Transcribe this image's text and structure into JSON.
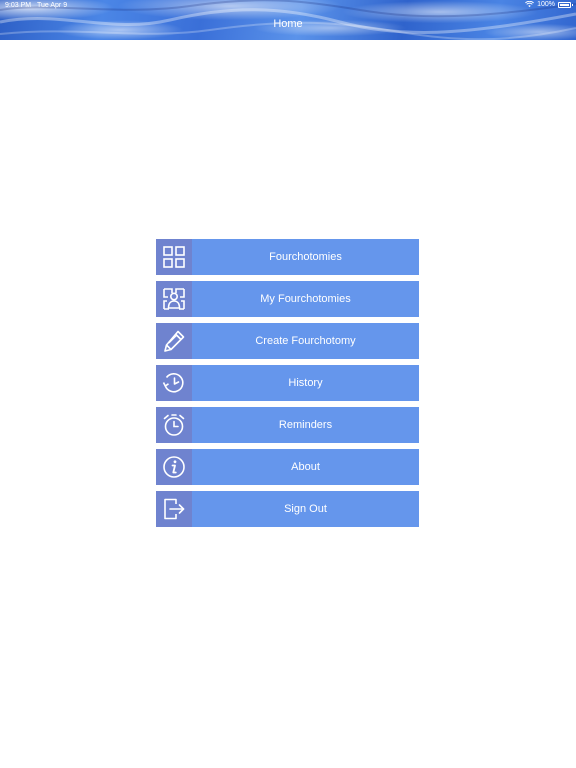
{
  "status_bar": {
    "time": "9:03 PM",
    "date": "Tue Apr 9",
    "battery": "100%"
  },
  "nav": {
    "title": "Home"
  },
  "colors": {
    "button_bg": "#6596ec",
    "icon_bg": "#6f83cf",
    "text": "#ffffff"
  },
  "menu": {
    "items": [
      {
        "label": "Fourchotomies",
        "icon": "grid-icon"
      },
      {
        "label": "My Fourchotomies",
        "icon": "my-grid-icon"
      },
      {
        "label": "Create Fourchotomy",
        "icon": "pencil-icon"
      },
      {
        "label": "History",
        "icon": "history-icon"
      },
      {
        "label": "Reminders",
        "icon": "alarm-clock-icon"
      },
      {
        "label": "About",
        "icon": "info-icon"
      },
      {
        "label": "Sign Out",
        "icon": "sign-out-icon"
      }
    ]
  }
}
